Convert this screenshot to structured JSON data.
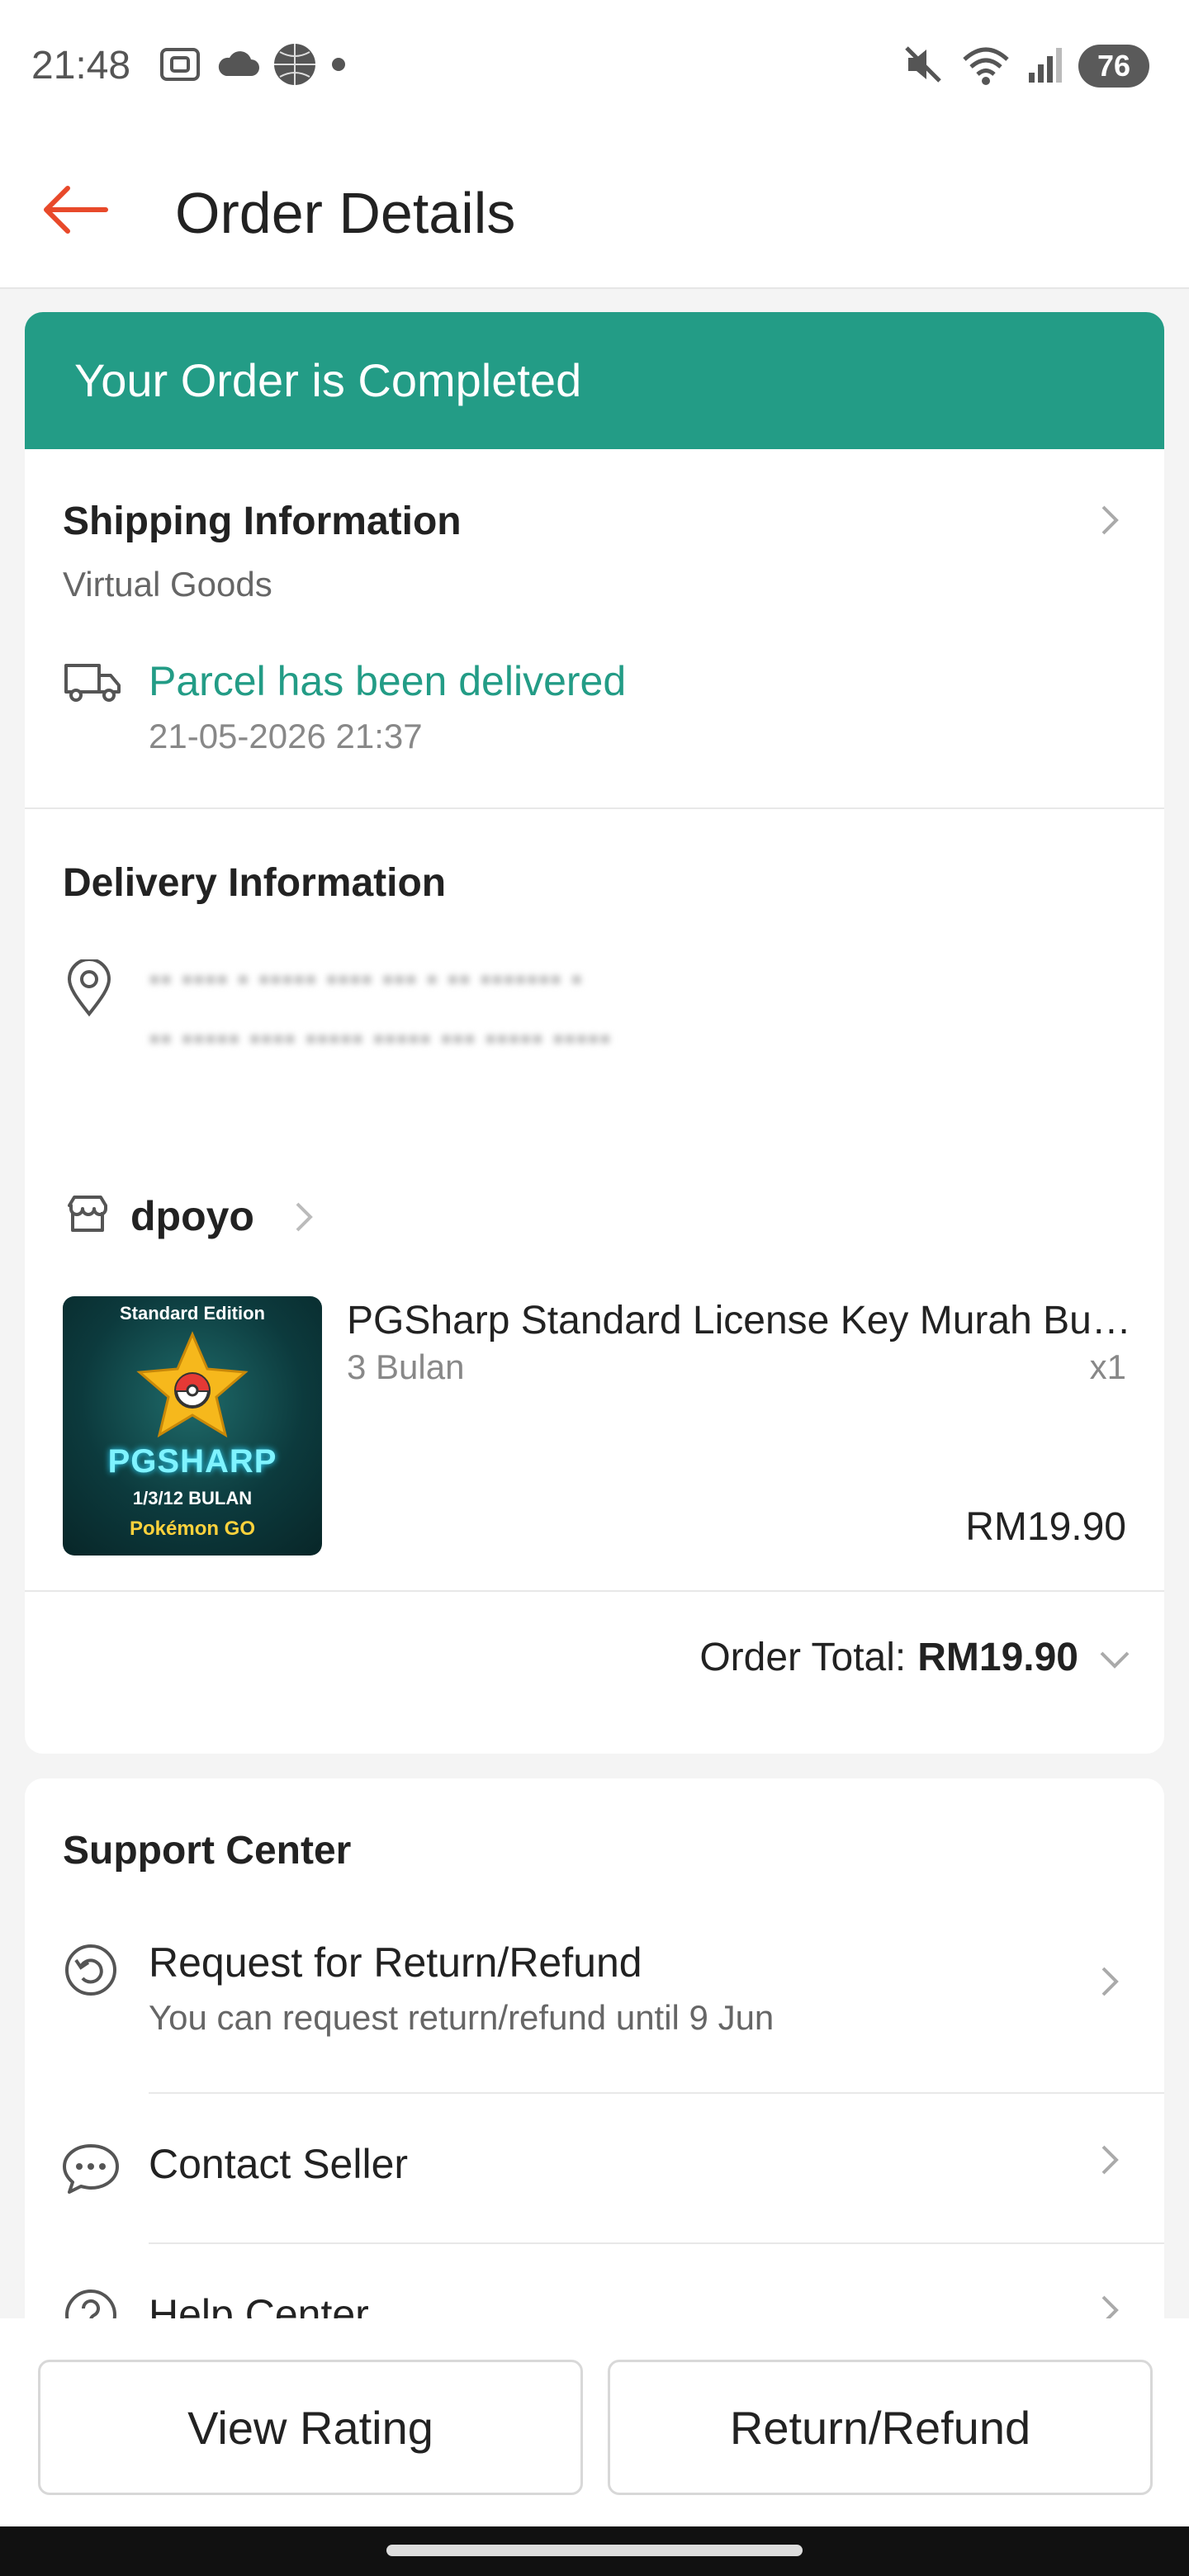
{
  "status_bar": {
    "time": "21:48",
    "left_icons": [
      "screenshot-icon",
      "cloud-icon",
      "vpn-globe-icon",
      "dot-icon"
    ],
    "right_icons": [
      "mute-icon",
      "wifi-icon",
      "signal-icon"
    ],
    "battery": "76"
  },
  "header": {
    "back_icon": "back-arrow-icon",
    "title": "Order Details"
  },
  "banner": {
    "text": "Your Order is Completed",
    "color": "#239c86"
  },
  "shipping": {
    "title": "Shipping Information",
    "subtitle": "Virtual Goods",
    "status": "Parcel has been delivered",
    "timestamp": "21-05-2026 21:37"
  },
  "delivery": {
    "title": "Delivery Information",
    "address_line1": "▪▪ ▪▪▪▪ ▪ ▪▪▪▪▪ ▪▪▪▪ ▪▪▪ ▪ ▪▪ ▪▪▪▪▪▪▪ ▪",
    "address_line2": "▪▪ ▪▪▪▪▪ ▪▪▪▪ ▪▪▪▪▪ ▪▪▪▪▪ ▪▪▪ ▪▪▪▪▪ ▪▪▪▪▪"
  },
  "shop": {
    "name": "dpoyo",
    "product": {
      "thumb_edition": "Standard Edition",
      "thumb_logo": "PGSHARP",
      "thumb_bulan": "1/3/12 BULAN",
      "thumb_game": "Pokémon GO",
      "name": "PGSharp Standard License Key Murah Bulan",
      "variant": "3 Bulan",
      "quantity": "x1",
      "price": "RM19.90"
    },
    "order_total_label": "Order Total:",
    "order_total_value": "RM19.90"
  },
  "support": {
    "title": "Support Center",
    "items": [
      {
        "label": "Request for Return/Refund",
        "sub": "You can request return/refund until 9 Jun",
        "icon": "return-icon"
      },
      {
        "label": "Contact Seller",
        "sub": "",
        "icon": "chat-icon"
      },
      {
        "label": "Help Center",
        "sub": "",
        "icon": "help-icon"
      }
    ]
  },
  "actions": {
    "view_rating": "View Rating",
    "return_refund": "Return/Refund"
  }
}
